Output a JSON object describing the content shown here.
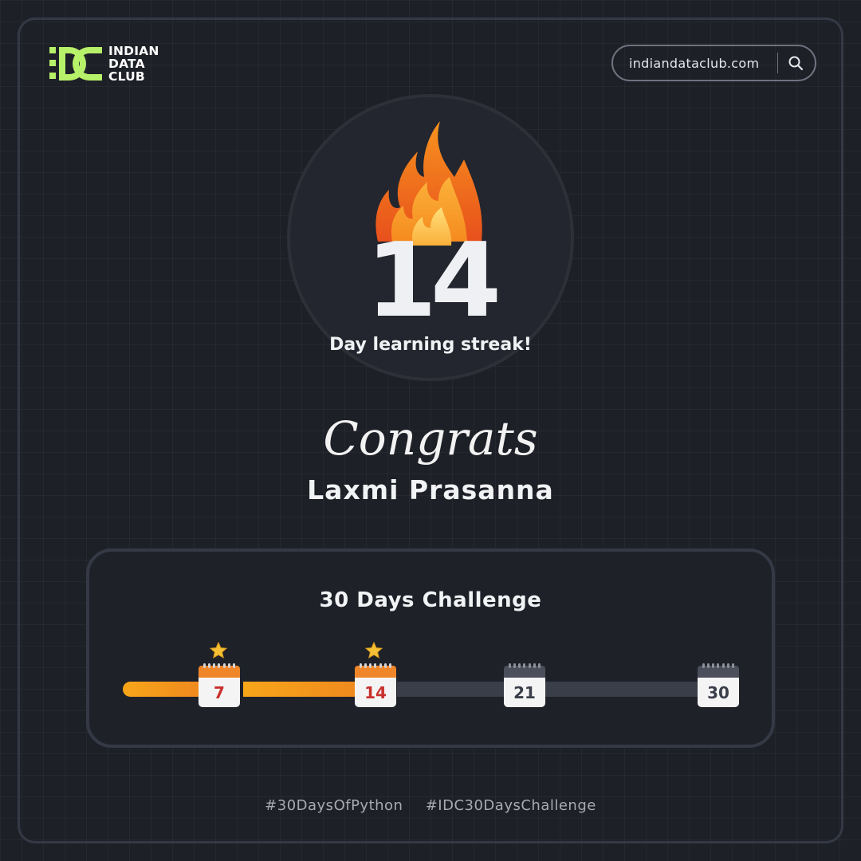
{
  "brand": {
    "logo_lines": [
      "INDIAN",
      "DATA",
      "CLUB"
    ],
    "accent_color": "#b7f069",
    "url": "indiandataclub.com",
    "search_icon": "search-icon"
  },
  "streak": {
    "days": "14",
    "label": "Day learning streak!",
    "icon": "flame-icon"
  },
  "congrats": {
    "heading": "Congrats",
    "name": "Laxmi Prasanna"
  },
  "challenge": {
    "title": "30 Days Challenge",
    "progress_days": 14,
    "total_days": 30,
    "milestones": [
      {
        "day": "7",
        "completed": true,
        "badge": "star-icon"
      },
      {
        "day": "14",
        "completed": true,
        "badge": "star-icon"
      },
      {
        "day": "21",
        "completed": false
      },
      {
        "day": "30",
        "completed": false
      }
    ],
    "colors": {
      "done": "#f7a619",
      "todo": "#3a3e49"
    }
  },
  "hashtags": [
    "#30DaysOfPython",
    "#IDC30DaysChallenge"
  ]
}
